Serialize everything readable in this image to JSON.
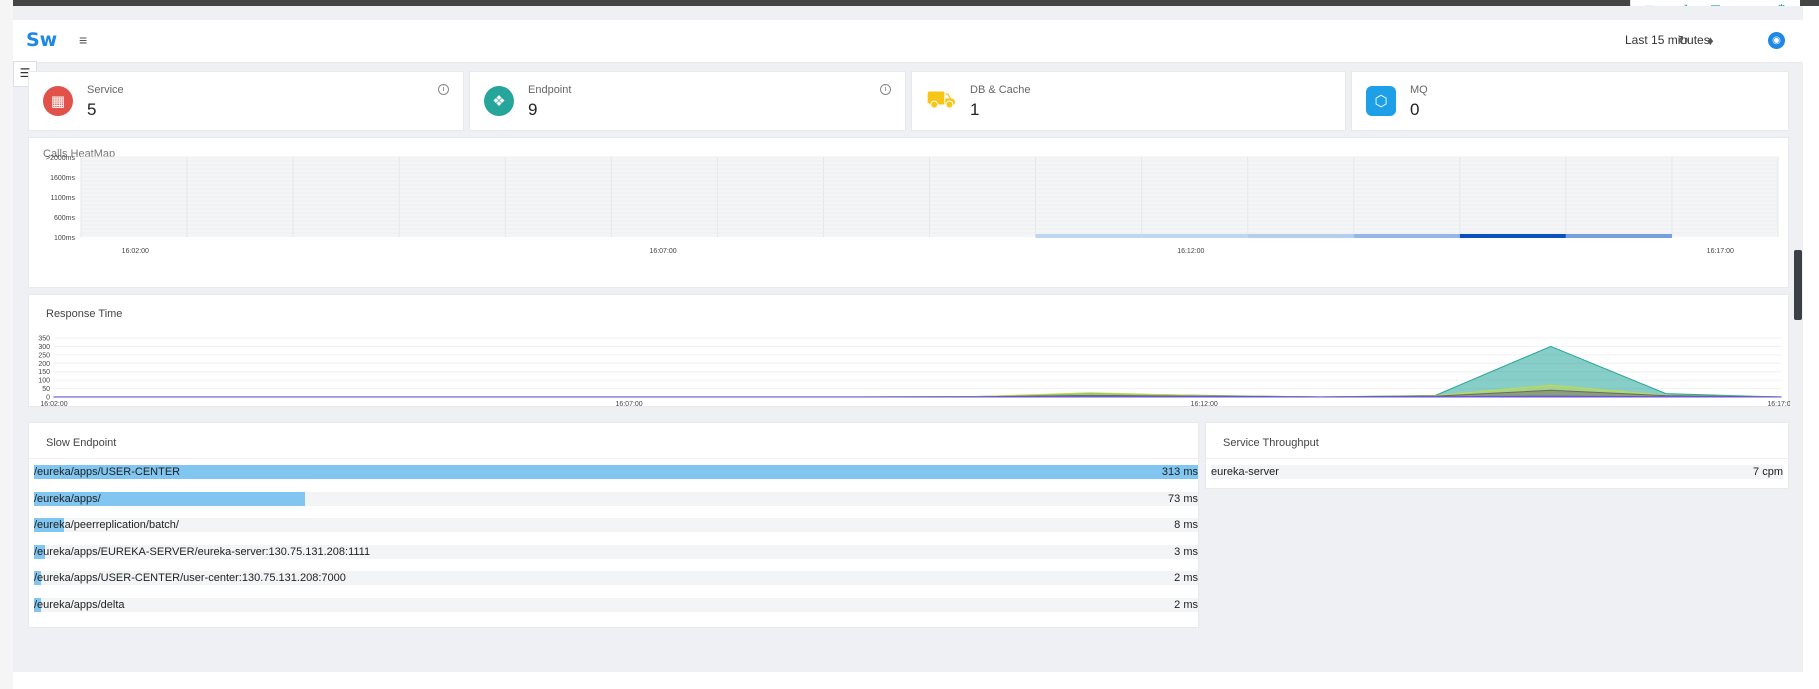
{
  "header": {
    "logo": "Sw",
    "time_range": "Last 15 minutes"
  },
  "icons": {
    "menu": "menu-icon",
    "refresh": "refresh-icon",
    "bell": "bell-icon",
    "user": "user-icon"
  },
  "cards": [
    {
      "label": "Service",
      "value": "5",
      "icon": "service-grid-icon",
      "color": "#e0524a",
      "info": true
    },
    {
      "label": "Endpoint",
      "value": "9",
      "icon": "endpoint-share-icon",
      "color": "#26a69a",
      "info": true
    },
    {
      "label": "DB & Cache",
      "value": "1",
      "icon": "database-icon",
      "color": "#f7c515",
      "info": false
    },
    {
      "label": "MQ",
      "value": "0",
      "icon": "mq-hexagon-icon",
      "color": "#1ea0e8",
      "info": false
    }
  ],
  "heatmap": {
    "title": "Calls HeatMap",
    "y_labels": [
      ">2000ms",
      "1600ms",
      "1100ms",
      "600ms",
      "100ms"
    ],
    "x_labels": [
      "16:02:00",
      "16:07:00",
      "16:12:00",
      "16:17:00"
    ]
  },
  "response_time": {
    "title": "Response Time",
    "y_labels": [
      "350",
      "300",
      "250",
      "200",
      "150",
      "100",
      "50",
      "0"
    ],
    "x_labels": [
      "16:02:00",
      "16:07:00",
      "16:12:00",
      "16:17:00"
    ]
  },
  "slow_endpoint": {
    "title": "Slow Endpoint",
    "rows": [
      {
        "name": "/eureka/apps/USER-CENTER",
        "ms": "313 ms",
        "value": 313
      },
      {
        "name": "/eureka/apps/",
        "ms": "73 ms",
        "value": 73
      },
      {
        "name": "/eureka/peerreplication/batch/",
        "ms": "8 ms",
        "value": 8
      },
      {
        "name": "/eureka/apps/EUREKA-SERVER/eureka-server:130.75.131.208:1111",
        "ms": "3 ms",
        "value": 3
      },
      {
        "name": "/eureka/apps/USER-CENTER/user-center:130.75.131.208:7000",
        "ms": "2 ms",
        "value": 2
      },
      {
        "name": "/eureka/apps/delta",
        "ms": "2 ms",
        "value": 2
      }
    ]
  },
  "service_throughput": {
    "title": "Service Throughput",
    "rows": [
      {
        "name": "eureka-server",
        "value": "7 cpm"
      }
    ]
  },
  "chart_data": [
    {
      "type": "heatmap",
      "title": "Calls HeatMap",
      "y_categories": [
        ">2000ms",
        "1600ms",
        "1100ms",
        "600ms",
        "100ms"
      ],
      "x_tick_labels": [
        "16:02:00",
        "16:07:00",
        "16:12:00",
        "16:17:00"
      ],
      "cells": [
        {
          "row": "100ms",
          "segment": 9,
          "intensity": 0.15
        },
        {
          "row": "100ms",
          "segment": 10,
          "intensity": 0.15
        },
        {
          "row": "100ms",
          "segment": 11,
          "intensity": 0.2
        },
        {
          "row": "100ms",
          "segment": 12,
          "intensity": 0.35
        },
        {
          "row": "100ms",
          "segment": 13,
          "intensity": 1.0
        },
        {
          "row": "100ms",
          "segment": 14,
          "intensity": 0.5
        }
      ]
    },
    {
      "type": "area",
      "title": "Response Time",
      "y_ticks": [
        0,
        50,
        100,
        150,
        200,
        250,
        300,
        350
      ],
      "ylim": [
        0,
        350
      ],
      "x_tick_labels": [
        "16:02:00",
        "16:07:00",
        "16:12:00",
        "16:17:00"
      ],
      "x_minutes": [
        0,
        1,
        2,
        3,
        4,
        5,
        6,
        7,
        8,
        9,
        10,
        11,
        12,
        13,
        14,
        15
      ],
      "series": [
        {
          "values": [
            0,
            0,
            0,
            0,
            0,
            0,
            0,
            0,
            3,
            20,
            10,
            0,
            10,
            300,
            20,
            0
          ],
          "color": "#26a69a"
        },
        {
          "values": [
            0,
            0,
            0,
            0,
            0,
            0,
            0,
            0,
            2,
            25,
            8,
            0,
            8,
            70,
            10,
            0
          ],
          "color": "#c5d94a"
        },
        {
          "values": [
            0,
            0,
            0,
            0,
            0,
            0,
            0,
            0,
            1,
            10,
            5,
            0,
            5,
            40,
            8,
            0
          ],
          "color": "#6a6a6a"
        },
        {
          "values": [
            1,
            1,
            1,
            1,
            1,
            1,
            1,
            1,
            1,
            2,
            2,
            1,
            2,
            5,
            2,
            1
          ],
          "color": "#6b55d6"
        }
      ]
    },
    {
      "type": "bar",
      "title": "Slow Endpoint",
      "categories": [
        "/eureka/apps/USER-CENTER",
        "/eureka/apps/",
        "/eureka/peerreplication/batch/",
        "/eureka/apps/EUREKA-SERVER/eureka-server:130.75.131.208:1111",
        "/eureka/apps/USER-CENTER/user-center:130.75.131.208:7000",
        "/eureka/apps/delta"
      ],
      "values": [
        313,
        73,
        8,
        3,
        2,
        2
      ]
    }
  ]
}
